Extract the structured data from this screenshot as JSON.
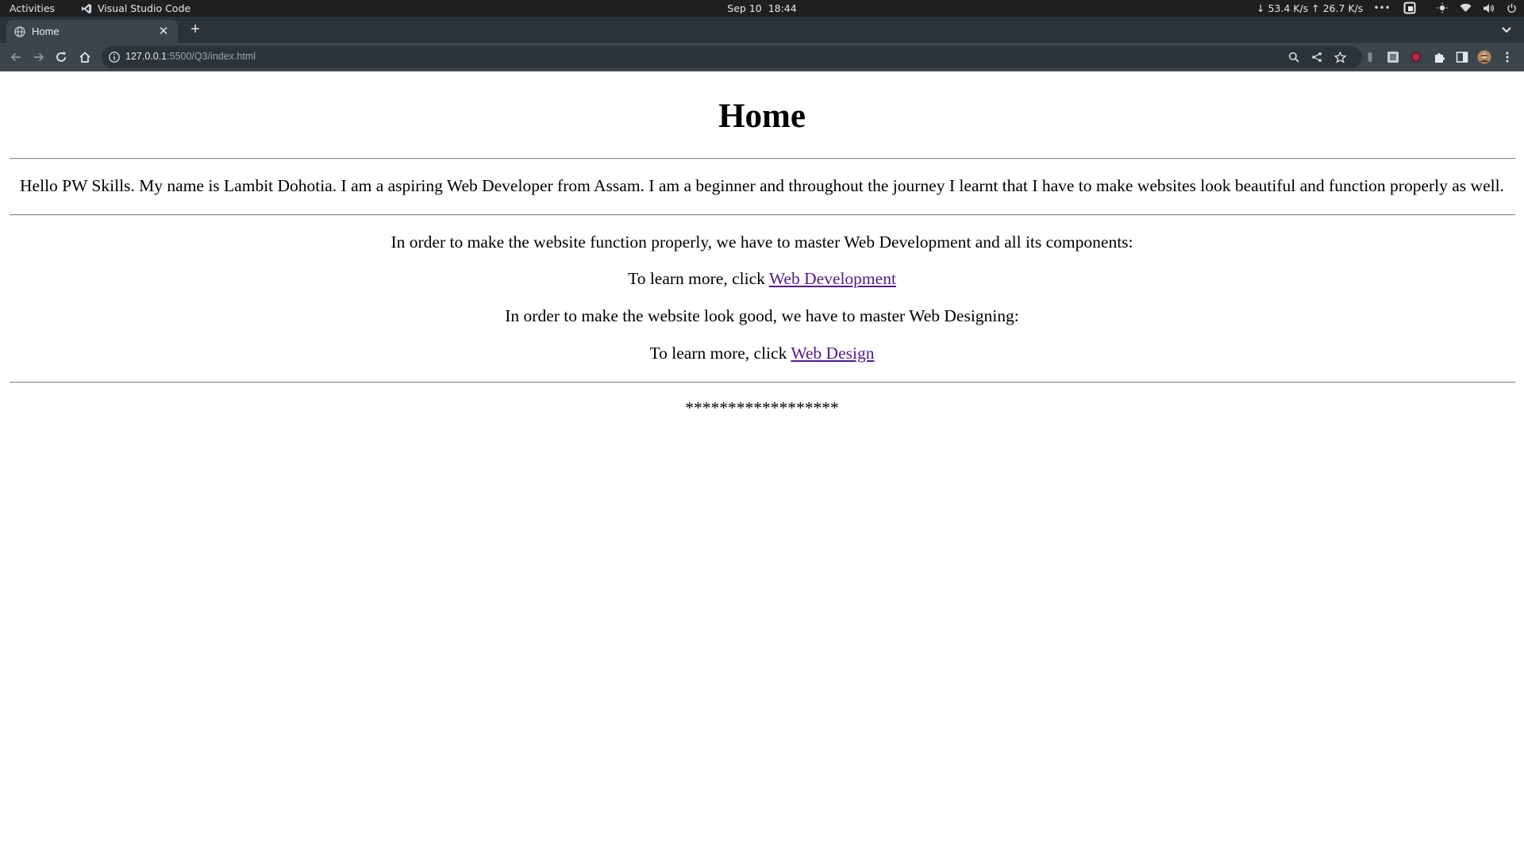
{
  "system_bar": {
    "activities": "Activities",
    "app_name": "Visual Studio Code",
    "date": "Sep 10",
    "time": "18:44",
    "net_speed": "↓ 53.4 K/s ↑ 26.7 K/s"
  },
  "browser": {
    "tab_title": "Home",
    "url_host": "127.0.0.1",
    "url_path": ":5500/Q3/index.html"
  },
  "page": {
    "heading": "Home",
    "intro": "Hello PW Skills. My name is Lambit Dohotia. I am a aspiring Web Developer from Assam. I am a beginner and throughout the journey I learnt that I have to make websites look beautiful and function properly as well.",
    "dev_text": "In order to make the website function properly, we have to master Web Development and all its components:",
    "learn_prefix_1": "To learn more, click ",
    "dev_link": "Web Development",
    "design_text": "In order to make the website look good, we have to master Web Designing:",
    "learn_prefix_2": "To learn more, click ",
    "design_link": "Web Design",
    "stars": "******************"
  },
  "colors": {
    "topbar": "#1d1f21",
    "tabstrip": "#2b3338",
    "toolbar": "#3b454c",
    "visited_link": "#551a8b"
  }
}
